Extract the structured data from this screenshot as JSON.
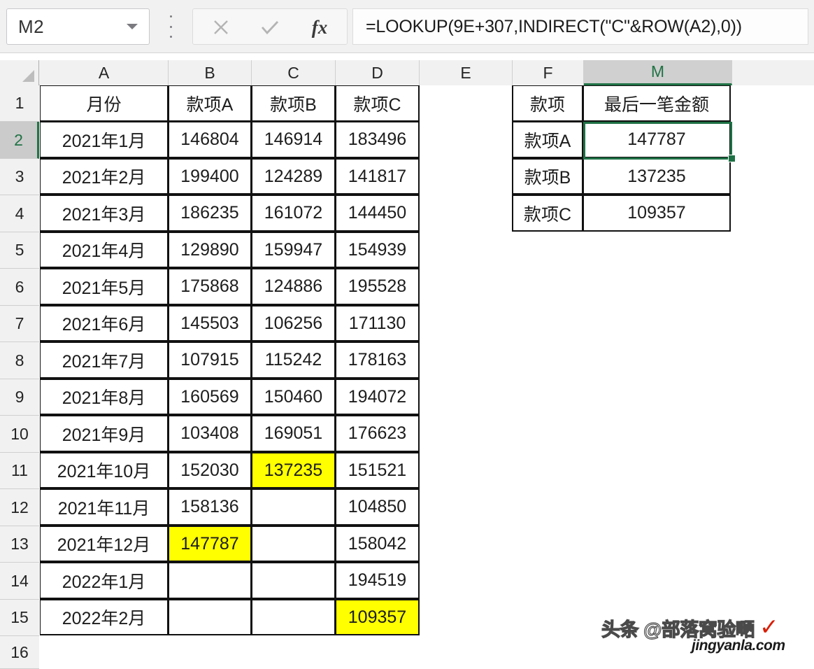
{
  "app": {
    "name_box_value": "M2",
    "formula": "=LOOKUP(9E+307,INDIRECT(\"C\"&ROW(A2),0))",
    "fx_label": "fx",
    "cancel_label": "cancel-formula",
    "enter_label": "confirm-formula"
  },
  "grid": {
    "column_headers": [
      "A",
      "B",
      "C",
      "D",
      "E",
      "F",
      "M"
    ],
    "selected_column": "M",
    "row_headers": [
      "1",
      "2",
      "3",
      "4",
      "5",
      "6",
      "7",
      "8",
      "9",
      "10",
      "11",
      "12",
      "13",
      "14",
      "15",
      "16"
    ],
    "selected_row": "2",
    "selected_cell": "M2"
  },
  "left_table": {
    "headers": [
      "月份",
      "款项A",
      "款项B",
      "款项C"
    ],
    "rows": [
      {
        "row": "2",
        "month": "2021年1月",
        "a": "146804",
        "b": "146914",
        "c": "183496"
      },
      {
        "row": "3",
        "month": "2021年2月",
        "a": "199400",
        "b": "124289",
        "c": "141817"
      },
      {
        "row": "4",
        "month": "2021年3月",
        "a": "186235",
        "b": "161072",
        "c": "144450"
      },
      {
        "row": "5",
        "month": "2021年4月",
        "a": "129890",
        "b": "159947",
        "c": "154939"
      },
      {
        "row": "6",
        "month": "2021年5月",
        "a": "175868",
        "b": "124886",
        "c": "195528"
      },
      {
        "row": "7",
        "month": "2021年6月",
        "a": "145503",
        "b": "106256",
        "c": "171130"
      },
      {
        "row": "8",
        "month": "2021年7月",
        "a": "107915",
        "b": "115242",
        "c": "178163"
      },
      {
        "row": "9",
        "month": "2021年8月",
        "a": "160569",
        "b": "150460",
        "c": "194072"
      },
      {
        "row": "10",
        "month": "2021年9月",
        "a": "103408",
        "b": "169051",
        "c": "176623"
      },
      {
        "row": "11",
        "month": "2021年10月",
        "a": "152030",
        "b": "137235",
        "c": "151521"
      },
      {
        "row": "12",
        "month": "2021年11月",
        "a": "158136",
        "b": "",
        "c": "104850"
      },
      {
        "row": "13",
        "month": "2021年12月",
        "a": "147787",
        "b": "",
        "c": "158042"
      },
      {
        "row": "14",
        "month": "2022年1月",
        "a": "",
        "b": "",
        "c": "194519"
      },
      {
        "row": "15",
        "month": "2022年2月",
        "a": "",
        "b": "",
        "c": "109357"
      }
    ],
    "highlighted_cells": [
      "C11",
      "B13",
      "D15"
    ],
    "highlight_color": "#ffff00"
  },
  "right_table": {
    "headers": [
      "款项",
      "最后一笔金额"
    ],
    "rows": [
      {
        "row": "2",
        "item": "款项A",
        "amount": "147787"
      },
      {
        "row": "3",
        "item": "款项B",
        "amount": "137235"
      },
      {
        "row": "4",
        "item": "款项C",
        "amount": "109357"
      }
    ]
  },
  "watermark": {
    "main": "头条 @部落窝验嗮",
    "site": "jingyanla.com",
    "check": "✓"
  },
  "colors": {
    "accent_green": "#217346",
    "selection_green": "#1e7145",
    "highlight_yellow": "#ffff00",
    "header_gray": "#f1f1f1",
    "selected_header_gray": "#d0d0d0"
  }
}
